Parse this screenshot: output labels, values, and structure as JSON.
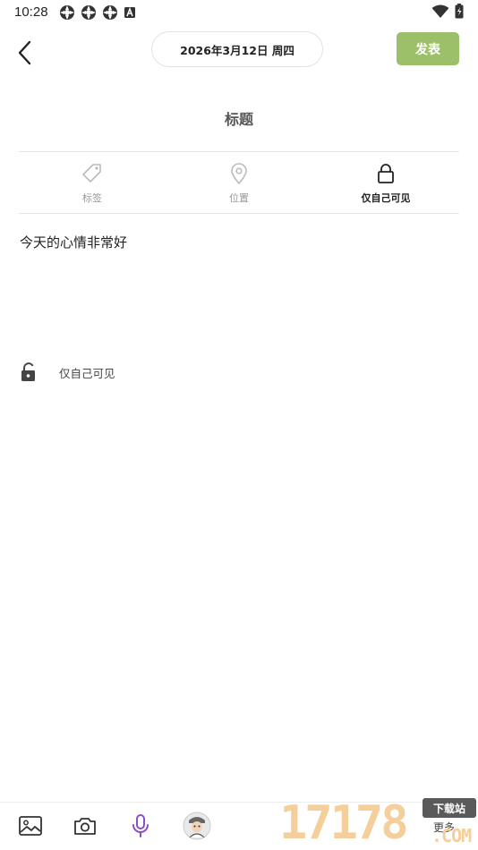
{
  "status_bar": {
    "time": "10:28"
  },
  "header": {
    "date": "2026年3月12日 周四",
    "publish_label": "发表"
  },
  "title_placeholder": "标题",
  "options": [
    {
      "label": "标签",
      "icon": "tag-icon",
      "active": false
    },
    {
      "label": "位置",
      "icon": "location-pin-icon",
      "active": false
    },
    {
      "label": "仅自己可见",
      "icon": "lock-icon",
      "active": true
    }
  ],
  "content": {
    "text": "今天的心情非常好"
  },
  "privacy": {
    "label": "仅自己可见"
  },
  "toolbar": {
    "items": [
      "image-icon",
      "camera-icon",
      "microphone-icon",
      "avatar-sticker-icon"
    ]
  },
  "watermark": {
    "number": "17178",
    "tag": "下载站",
    "more": "更多",
    "com": ".COM"
  },
  "colors": {
    "accent": "#9cc06a",
    "mic": "#8a4fc7",
    "watermark": "#f4cf9c"
  }
}
